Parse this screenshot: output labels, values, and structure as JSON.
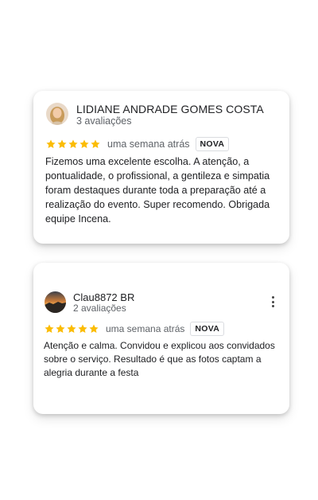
{
  "reviews": [
    {
      "author": "LIDIANE ANDRADE GOMES COSTA",
      "review_count": "3 avaliações",
      "rating": 5,
      "time": "uma semana atrás",
      "badge": "NOVA",
      "text": "Fizemos uma excelente escolha. A atenção, a pontualidade, o profissional, a gentileza e simpatia foram destaques durante toda a preparação até a realização do evento. Super recomendo. Obrigada equipe Incena."
    },
    {
      "author": "Clau8872 BR",
      "review_count": "2 avaliações",
      "rating": 5,
      "time": "uma semana atrás",
      "badge": "NOVA",
      "text": "Atenção e calma.  Convidou e explicou aos convidados sobre o serviço. Resultado é que as fotos captam a alegria durante a festa"
    }
  ],
  "colors": {
    "star": "#fbbc04",
    "text": "#202124",
    "secondary": "#5f6368"
  },
  "icons": [
    "star-icon",
    "more-options-icon"
  ]
}
